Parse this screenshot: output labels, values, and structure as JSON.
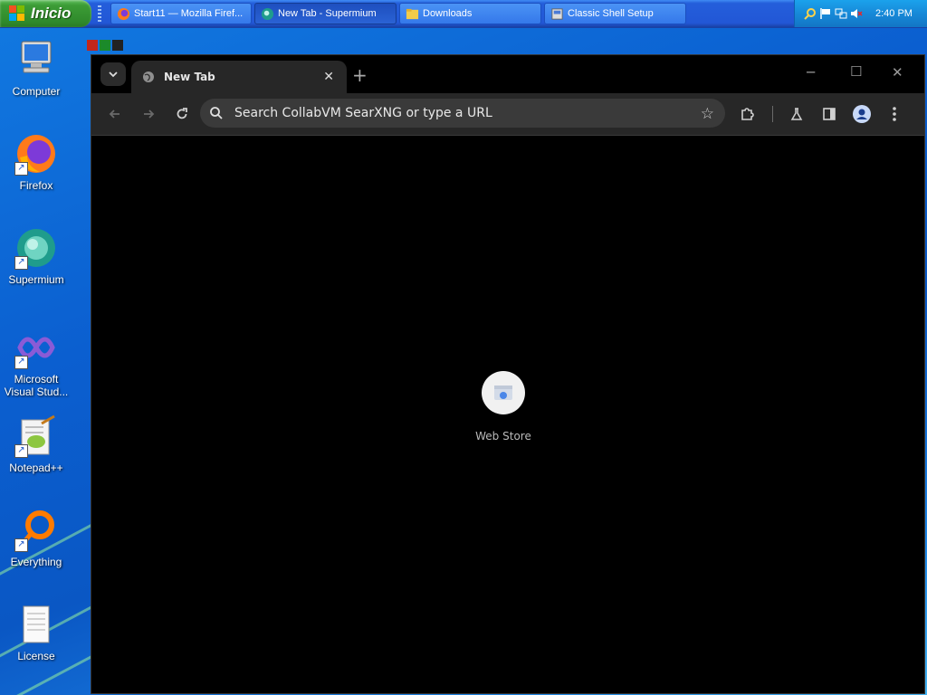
{
  "taskbar": {
    "start_label": "Inicio",
    "tasks": [
      {
        "label": "Start11 — Mozilla Firef..."
      },
      {
        "label": "New Tab - Supermium"
      },
      {
        "label": "Downloads"
      },
      {
        "label": "Classic Shell Setup"
      }
    ],
    "clock": "2:40 PM"
  },
  "desktop": {
    "icons": [
      {
        "label": "Computer"
      },
      {
        "label": "Firefox"
      },
      {
        "label": "Supermium"
      },
      {
        "label": "Microsoft Visual Stud..."
      },
      {
        "label": "Notepad++"
      },
      {
        "label": "Everything"
      },
      {
        "label": "License"
      }
    ]
  },
  "browser": {
    "tab_title": "New Tab",
    "omnibox_placeholder": "Search CollabVM SearXNG or type a URL",
    "shortcuts": [
      {
        "label": "Web Store"
      }
    ]
  },
  "colors": {
    "taskbar_blue": "#245edb",
    "start_green": "#3c9c36",
    "browser_bg": "#000000",
    "toolbar_bg": "#272727"
  }
}
